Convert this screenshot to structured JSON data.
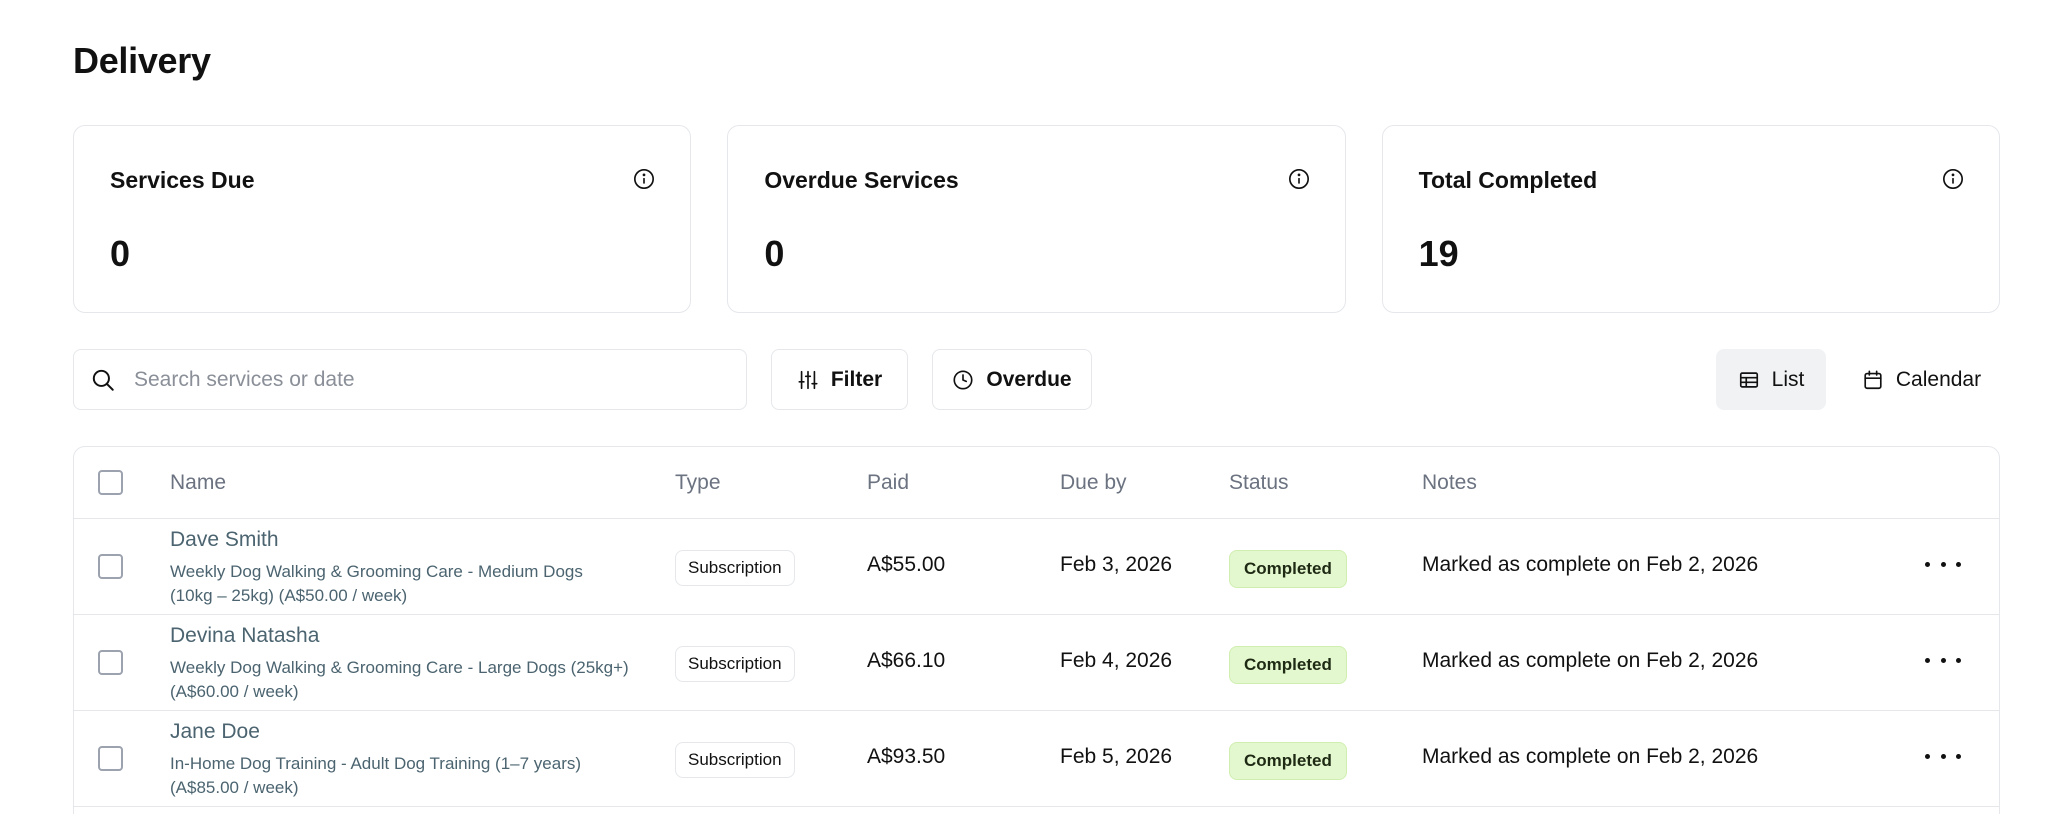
{
  "page": {
    "title": "Delivery"
  },
  "stats": [
    {
      "title": "Services Due",
      "value": "0",
      "icon": "info-icon"
    },
    {
      "title": "Overdue Services",
      "value": "0",
      "icon": "info-icon"
    },
    {
      "title": "Total Completed",
      "value": "19",
      "icon": "info-icon"
    }
  ],
  "toolbar": {
    "search_placeholder": "Search services or date",
    "search_value": "",
    "filter_label": "Filter",
    "overdue_label": "Overdue",
    "list_label": "List",
    "calendar_label": "Calendar",
    "active_view": "List"
  },
  "table": {
    "headers": {
      "name": "Name",
      "type": "Type",
      "paid": "Paid",
      "due": "Due by",
      "status": "Status",
      "notes": "Notes"
    },
    "rows": [
      {
        "name": "Dave Smith",
        "service": "Weekly Dog Walking & Grooming Care - Medium Dogs (10kg – 25kg) (A$50.00 / week)",
        "type": "Subscription",
        "paid": "A$55.00",
        "due": "Feb 3, 2026",
        "status": "Completed",
        "notes": "Marked as complete on Feb 2, 2026"
      },
      {
        "name": "Devina Natasha",
        "service": "Weekly Dog Walking & Grooming Care - Large Dogs (25kg+) (A$60.00 / week)",
        "type": "Subscription",
        "paid": "A$66.10",
        "due": "Feb 4, 2026",
        "status": "Completed",
        "notes": "Marked as complete on Feb 2, 2026"
      },
      {
        "name": "Jane Doe",
        "service": "In-Home Dog Training - Adult Dog Training (1–7 years) (A$85.00 / week)",
        "type": "Subscription",
        "paid": "A$93.50",
        "due": "Feb 5, 2026",
        "status": "Completed",
        "notes": "Marked as complete on Feb 2, 2026"
      }
    ]
  },
  "colors": {
    "status_completed_bg": "#e4f8cf",
    "name_link": "#4b6470",
    "border": "#e5e7eb"
  }
}
